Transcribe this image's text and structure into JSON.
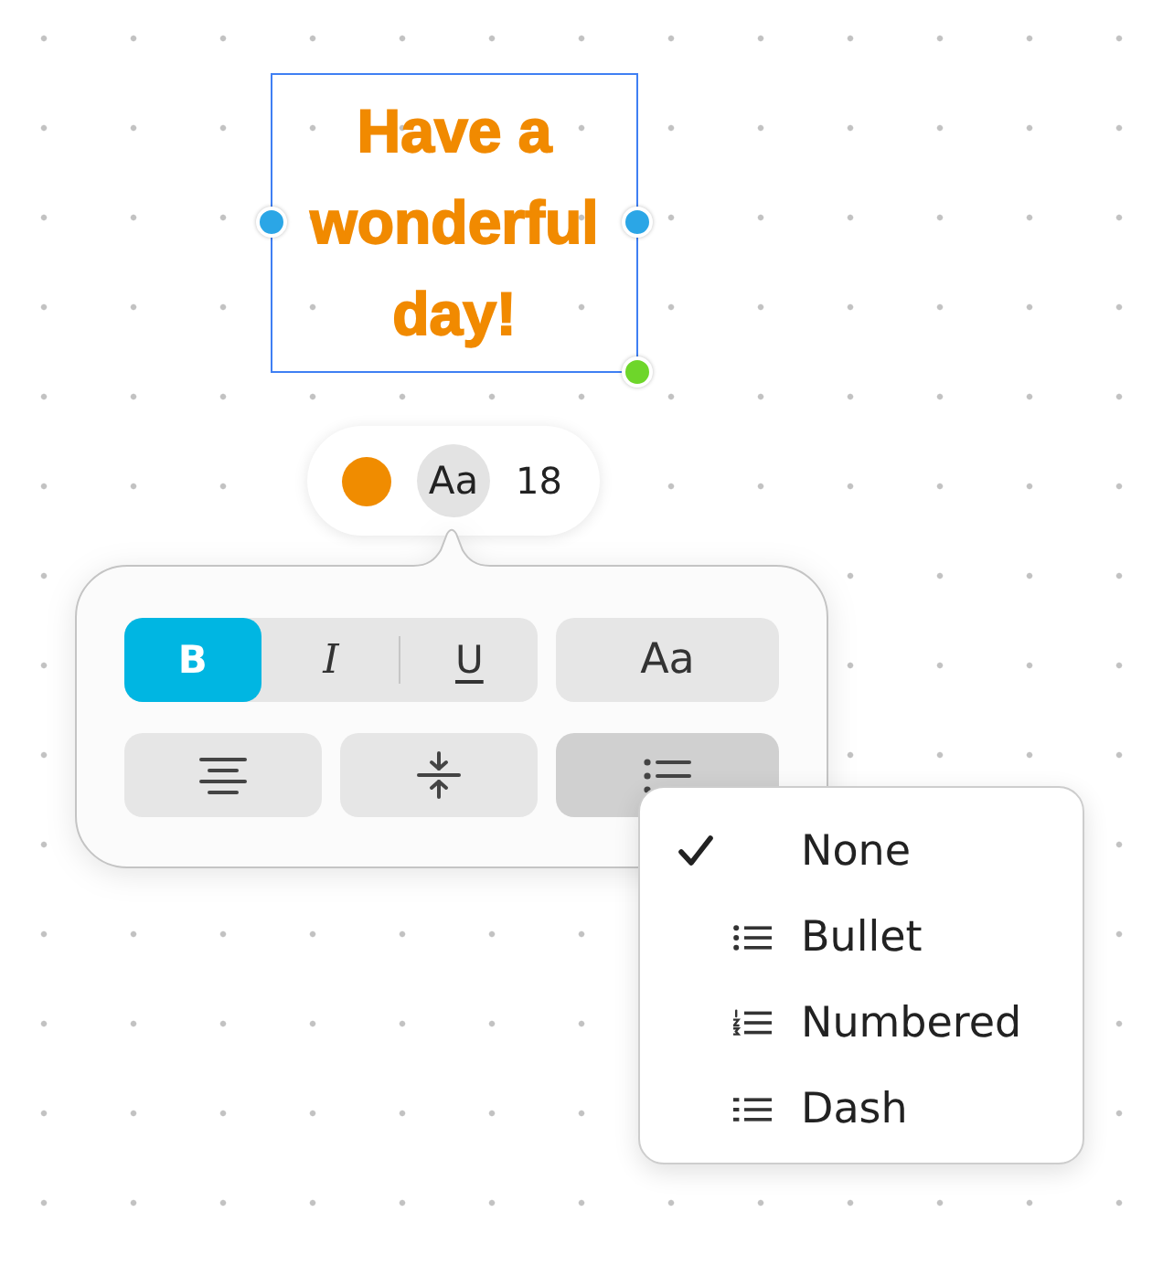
{
  "canvas": {
    "text_box": {
      "text": "Have a wonderful day!",
      "selected": true
    }
  },
  "mini_toolbar": {
    "font_button": {
      "label": "Aa",
      "expanded": true
    },
    "font_size": "18"
  },
  "format_panel": {
    "style_buttons": [
      {
        "label": "B",
        "kind": "bold",
        "selected": true
      },
      {
        "label": "I",
        "kind": "italic",
        "selected": false
      },
      {
        "label": "U",
        "kind": "underline",
        "selected": false
      }
    ],
    "text_style_button": "Aa",
    "paragraph_buttons": [
      {
        "kind": "align",
        "expanded": false
      },
      {
        "kind": "valign",
        "expanded": false
      },
      {
        "kind": "list",
        "expanded": true
      }
    ]
  },
  "list_menu": {
    "items": [
      {
        "label": "None",
        "kind": "none",
        "selected": true
      },
      {
        "label": "Bullet",
        "kind": "bullet",
        "selected": false
      },
      {
        "label": "Numbered",
        "kind": "numbered",
        "selected": false
      },
      {
        "label": "Dash",
        "kind": "dash",
        "selected": false
      }
    ]
  }
}
